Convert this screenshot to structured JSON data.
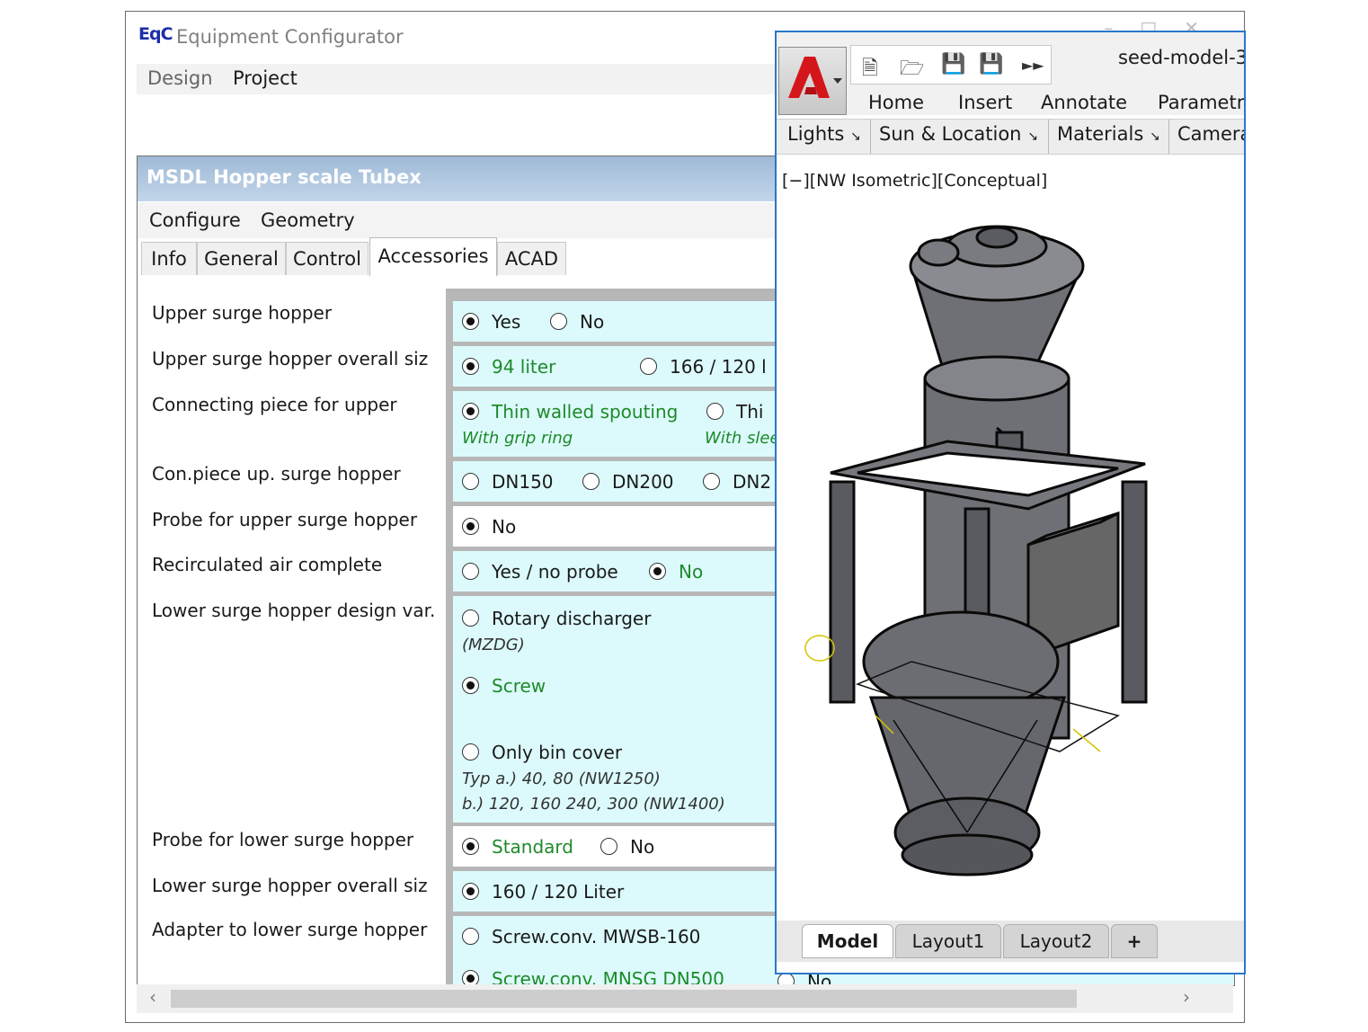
{
  "app": {
    "logo": "EqC",
    "title": "Equipment Configurator",
    "menu": [
      "Design",
      "Project"
    ]
  },
  "doc": {
    "title": "MSDL Hopper scale Tubex",
    "menu": [
      "Configure",
      "Geometry"
    ],
    "tabs": [
      "Info",
      "General",
      "Control",
      "Accessories",
      "ACAD"
    ],
    "active_tab": "Accessories"
  },
  "form": {
    "upper_surge_hopper": {
      "label": "Upper surge hopper",
      "options": [
        "Yes",
        "No"
      ],
      "selected": "Yes"
    },
    "upper_size": {
      "label": "Upper surge hopper overall siz",
      "options": [
        "94 liter",
        "166 / 120 l"
      ],
      "selected": "94 liter"
    },
    "connecting_piece": {
      "label": "Connecting piece for upper",
      "options": [
        "Thin walled spouting",
        "Thi"
      ],
      "notes": [
        "With grip ring",
        "With slee"
      ],
      "selected": "Thin walled spouting"
    },
    "con_piece_dn": {
      "label": "Con.piece up. surge hopper",
      "options": [
        "DN150",
        "DN200",
        "DN2"
      ],
      "selected": ""
    },
    "probe_upper": {
      "label": "Probe for upper surge hopper",
      "options": [
        "No"
      ],
      "selected": "No"
    },
    "recirculated_air": {
      "label": "Recirculated air complete",
      "options": [
        "Yes / no probe",
        "No"
      ],
      "selected": "No"
    },
    "lower_design": {
      "label": "Lower surge hopper design var.",
      "options": [
        "Rotary discharger",
        "Screw",
        "Only bin cover"
      ],
      "notes": [
        "(MZDG)",
        "Typ a.) 40, 80 (NW1250)",
        "b.) 120, 160 240, 300 (NW1400)"
      ],
      "selected": "Screw"
    },
    "probe_lower": {
      "label": "Probe for lower surge hopper",
      "options": [
        "Standard",
        "No"
      ],
      "selected": "Standard"
    },
    "lower_size": {
      "label": "Lower surge hopper overall siz",
      "options": [
        "160 / 120 Liter"
      ],
      "selected": "160 / 120 Liter"
    },
    "adapter_lower": {
      "label": "Adapter to lower surge hopper",
      "options": [
        "Screw.conv. MWSB-160",
        "Screw.conv. MNSG DN500"
      ],
      "selected": "Screw.conv. MNSG DN500"
    },
    "behind_text": "No"
  },
  "cad": {
    "file_title": "seed-model-3",
    "ribbon_tabs": [
      "Home",
      "Insert",
      "Annotate",
      "Parametri"
    ],
    "panels": [
      "Lights",
      "Sun & Location",
      "Materials",
      "Camera"
    ],
    "panel_launcher": "↘",
    "viewport_label": "[−][NW Isometric][Conceptual]",
    "layout_tabs": [
      "Model",
      "Layout1",
      "Layout2"
    ],
    "add_layout": "+",
    "active_layout": "Model"
  },
  "colors": {
    "field_bg": "#dcfafc",
    "selected_text": "#1e8a2a",
    "doc_title_bg": "#aac3de",
    "cad_border": "#2b77c9",
    "model_gray": "#6f7076"
  }
}
